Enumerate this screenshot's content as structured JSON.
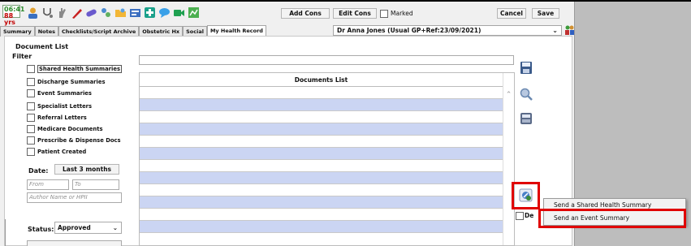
{
  "patient": {
    "time": "06:41",
    "age": "88 yrs"
  },
  "toolbar": {
    "add_cons": "Add Cons",
    "edit_cons": "Edit Cons",
    "marked": "Marked",
    "cancel": "Cancel",
    "save": "Save"
  },
  "tabs": [
    "Summary",
    "Notes",
    "Checklists/Script Archive",
    "Obstetric Hx",
    "Social",
    "My Health Record"
  ],
  "provider": {
    "selected": "Dr Anna Jones (Usual GP+Ref:23/09/2021)"
  },
  "panel": {
    "title": "Document List",
    "filter_label": "Filter"
  },
  "filters": [
    "Shared Health Summaries",
    "Discharge Summaries",
    "Event Summaries",
    "Specialist Letters",
    "Referral Letters",
    "Medicare Documents",
    "Prescribe & Dispense Docs",
    "Patient Created"
  ],
  "date": {
    "label": "Date:",
    "range": "Last 3 months",
    "from_placeholder": "From",
    "to_placeholder": "To"
  },
  "author": {
    "placeholder": "Author Name or HPII"
  },
  "status": {
    "label": "Status:",
    "value": "Approved"
  },
  "documents": {
    "header": "Documents List"
  },
  "side_checkbox_label": "De",
  "context_menu": {
    "items": [
      "Send a Shared Health Summary",
      "Send an Event Summary"
    ]
  },
  "colors": {
    "row_blue": "#cbd5f3",
    "highlight_red": "#e00000",
    "time_green": "#2a8a2a",
    "age_red": "#c00000"
  }
}
